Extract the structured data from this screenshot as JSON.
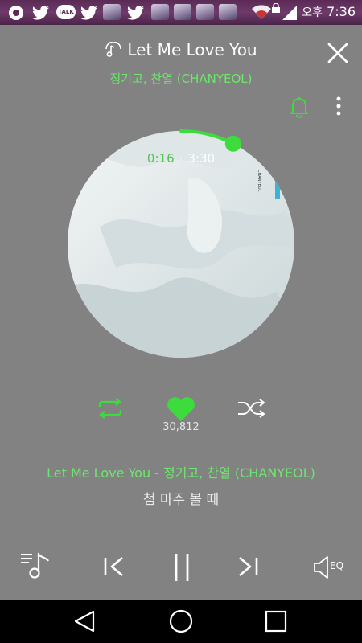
{
  "status_bar": {
    "ampm": "오후",
    "time": "7:36",
    "talk_badge": "TALK",
    "icons": [
      "record-icon",
      "twitter-icon",
      "talk-icon",
      "twitter-icon",
      "photo-icon",
      "twitter-icon",
      "photo-icon",
      "photo-icon",
      "photo-icon",
      "photo-icon",
      "photo-icon",
      "wifi-icon",
      "lock-icon",
      "signal-icon"
    ]
  },
  "header": {
    "title": "Let Me Love You",
    "artist": "정기고, 찬열 (CHANYEOL)",
    "icons": [
      "song-info-icon",
      "close-icon",
      "bell-icon",
      "more-icon"
    ]
  },
  "player": {
    "current_time": "0:16",
    "separator": "·",
    "total_time": "3:30",
    "progress": 0.076,
    "album_label": "CHANYEOL",
    "like_count": "30,812",
    "accent_color": "#3ddc3d"
  },
  "lyrics": {
    "line1": "Let Me Love You - 정기고, 찬열 (CHANYEOL)",
    "line2": "첨 마주 볼 때"
  },
  "controls": {
    "eq_label": "EQ",
    "icons": [
      "repeat-icon",
      "heart-icon",
      "shuffle-icon",
      "playlist-icon",
      "previous-icon",
      "pause-icon",
      "next-icon",
      "eq-speaker-icon"
    ]
  },
  "navbar": {
    "icons": [
      "back-icon",
      "home-icon",
      "recent-apps-icon"
    ]
  }
}
